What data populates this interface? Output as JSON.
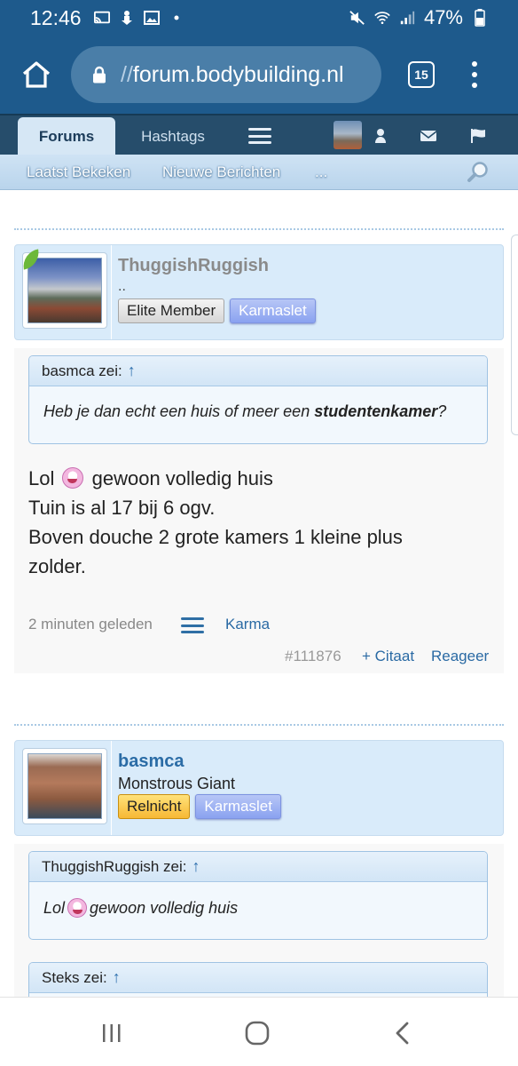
{
  "status_bar": {
    "time": "12:46",
    "battery": "47%",
    "icons": [
      "cast-icon",
      "download-icon",
      "image-icon",
      "dot-icon",
      "mute-icon",
      "wifi-icon",
      "signal-icon",
      "battery-icon"
    ]
  },
  "browser": {
    "url_prefix": "//",
    "url_host": "forum.bodybuilding.nl",
    "tab_count": "15"
  },
  "forum_nav": {
    "tabs": [
      {
        "label": "Forums"
      },
      {
        "label": "Hashtags"
      }
    ],
    "subnav": [
      {
        "label": "Laatst Bekeken"
      },
      {
        "label": "Nieuwe Berichten"
      },
      {
        "label": "..."
      }
    ]
  },
  "posts": [
    {
      "username": "ThuggishRuggish",
      "user_title": "..",
      "badges": [
        "Elite Member",
        "Karmaslet"
      ],
      "quote": {
        "author": "basmca zei:",
        "arrow": "↑",
        "text_before": "Heb je dan echt een huis of meer een ",
        "text_bold": "studentenkamer",
        "text_after": "?"
      },
      "message_lines": [
        "Lol",
        "gewoon volledig huis",
        "Tuin is al 17 bij 6 ogv.",
        "Boven douche 2 grote kamers 1 kleine plus",
        "zolder."
      ],
      "time": "2 minuten geleden",
      "karma": "Karma",
      "post_number": "#111876",
      "cite": "+ Citaat",
      "reply": "Reageer"
    },
    {
      "username": "basmca",
      "user_title": "Monstrous Giant",
      "badges": [
        "Relnicht",
        "Karmaslet"
      ],
      "quote": {
        "author": "ThuggishRuggish zei:",
        "arrow": "↑",
        "text_before": "Lol",
        "text_after": "gewoon volledig huis"
      },
      "quote2": {
        "author": "Steks zei:",
        "arrow": "↑"
      }
    }
  ],
  "colors": {
    "brand_blue": "#1e5a8c",
    "nav_dark": "#264d6b",
    "link": "#2a6aa4",
    "online": "#6cb83a"
  }
}
